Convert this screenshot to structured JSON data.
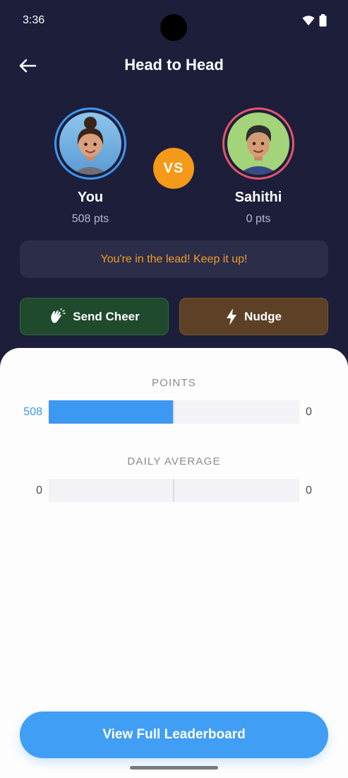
{
  "status_bar": {
    "time": "3:36"
  },
  "header": {
    "title": "Head to Head"
  },
  "players": {
    "you": {
      "name": "You",
      "points_text": "508 pts"
    },
    "opponent": {
      "name": "Sahithi",
      "points_text": "0 pts"
    }
  },
  "vs_label": "VS",
  "lead_message": "You're in the lead! Keep it up!",
  "actions": {
    "cheer_label": "Send Cheer",
    "nudge_label": "Nudge"
  },
  "stats": [
    {
      "label": "POINTS",
      "you_value": "508",
      "opponent_value": "0",
      "you_fraction": 1.0,
      "opponent_fraction": 0.0
    },
    {
      "label": "DAILY AVERAGE",
      "you_value": "0",
      "opponent_value": "0",
      "you_fraction": 0.0,
      "opponent_fraction": 0.0
    }
  ],
  "footer": {
    "leaderboard_label": "View Full Leaderboard"
  },
  "colors": {
    "background": "#1d1e3a",
    "you_accent": "#3d98f2",
    "opponent_accent": "#e5566c",
    "vs_badge": "#f49a18",
    "lead_text": "#f39c2c",
    "cheer_button": "#1f4a2d",
    "nudge_button": "#5c4127",
    "leaderboard_button": "#419ef5"
  }
}
